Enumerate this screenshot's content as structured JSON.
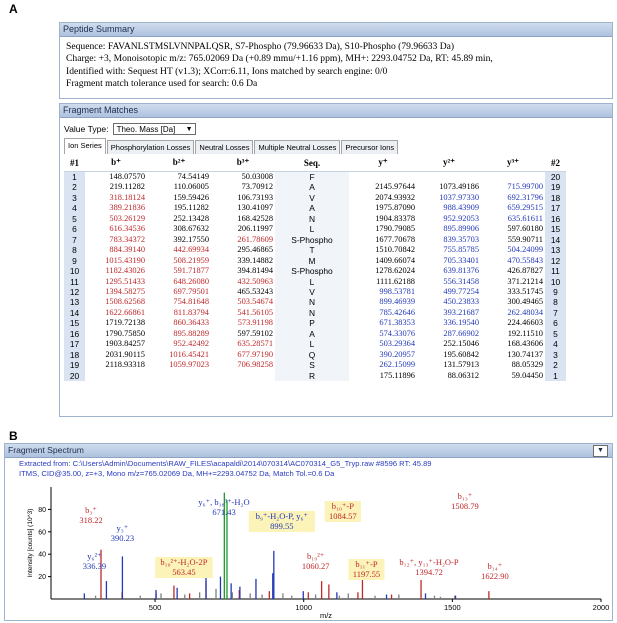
{
  "panel_labels": {
    "a": "A",
    "b": "B"
  },
  "summary": {
    "title": "Peptide Summary",
    "lines": [
      "Sequence: FAVANLSTMSLVNNPALQSR, S7-Phospho (79.96633 Da), S10-Phospho (79.96633 Da)",
      "Charge: +3,   Monoisotopic m/z: 765.02069 Da (+0.89 mmu/+1.16 ppm),     MH+: 2293.04752 Da,    RT: 45.89 min,",
      "Identified with: Sequest HT (v1.3); XCorr:6.11, Ions matched by search engine: 0/0",
      "Fragment match tolerance used for search: 0.6 Da"
    ]
  },
  "fragment_matches": {
    "title": "Fragment Matches",
    "value_type_label": "Value Type:",
    "value_type_selected": "Theo. Mass [Da]",
    "tabs": [
      "Ion Series",
      "Phosphorylation Losses",
      "Neutral Losses",
      "Multiple Neutral Losses",
      "Precursor Ions"
    ],
    "headers": {
      "idx1": "#1",
      "b1": "b⁺",
      "b2": "b²⁺",
      "b3": "b³⁺",
      "seq": "Seq.",
      "y1": "y⁺",
      "y2": "y²⁺",
      "y3": "y³⁺",
      "idx2": "#2"
    },
    "colors": {
      "matched_b": "#c0282a",
      "matched_y": "#2238b8",
      "plain": "#000000"
    },
    "rows": [
      {
        "n1": "1",
        "b1": "148.07570",
        "b2": "74.54149",
        "b3": "50.03008",
        "seq": "F",
        "y1": "",
        "y2": "",
        "y3": "",
        "n2": "20",
        "bc": [
          0,
          0,
          0
        ],
        "yc": [
          0,
          0,
          0
        ]
      },
      {
        "n1": "2",
        "b1": "219.11282",
        "b2": "110.06005",
        "b3": "73.70912",
        "seq": "A",
        "y1": "2145.97644",
        "y2": "1073.49186",
        "y3": "715.99700",
        "n2": "19",
        "bc": [
          0,
          0,
          0
        ],
        "yc": [
          0,
          0,
          1
        ]
      },
      {
        "n1": "3",
        "b1": "318.18124",
        "b2": "159.59426",
        "b3": "106.73193",
        "seq": "V",
        "y1": "2074.93932",
        "y2": "1037.97330",
        "y3": "692.31796",
        "n2": "18",
        "bc": [
          1,
          0,
          0
        ],
        "yc": [
          0,
          1,
          1
        ]
      },
      {
        "n1": "4",
        "b1": "389.21836",
        "b2": "195.11282",
        "b3": "130.41097",
        "seq": "A",
        "y1": "1975.87090",
        "y2": "988.43909",
        "y3": "659.29515",
        "n2": "17",
        "bc": [
          1,
          0,
          0
        ],
        "yc": [
          0,
          1,
          1
        ]
      },
      {
        "n1": "5",
        "b1": "503.26129",
        "b2": "252.13428",
        "b3": "168.42528",
        "seq": "N",
        "y1": "1904.83378",
        "y2": "952.92053",
        "y3": "635.61611",
        "n2": "16",
        "bc": [
          1,
          0,
          0
        ],
        "yc": [
          0,
          1,
          1
        ]
      },
      {
        "n1": "6",
        "b1": "616.34536",
        "b2": "308.67632",
        "b3": "206.11997",
        "seq": "L",
        "y1": "1790.79085",
        "y2": "895.89906",
        "y3": "597.60180",
        "n2": "15",
        "bc": [
          1,
          0,
          0
        ],
        "yc": [
          0,
          1,
          0
        ]
      },
      {
        "n1": "7",
        "b1": "783.34372",
        "b2": "392.17550",
        "b3": "261.78609",
        "seq": "S-Phospho",
        "y1": "1677.70678",
        "y2": "839.35703",
        "y3": "559.90711",
        "n2": "14",
        "bc": [
          1,
          0,
          1
        ],
        "yc": [
          0,
          1,
          0
        ]
      },
      {
        "n1": "8",
        "b1": "884.39140",
        "b2": "442.69934",
        "b3": "295.46865",
        "seq": "T",
        "y1": "1510.70842",
        "y2": "755.85785",
        "y3": "504.24099",
        "n2": "13",
        "bc": [
          1,
          1,
          0
        ],
        "yc": [
          0,
          1,
          1
        ]
      },
      {
        "n1": "9",
        "b1": "1015.43190",
        "b2": "508.21959",
        "b3": "339.14882",
        "seq": "M",
        "y1": "1409.66074",
        "y2": "705.33401",
        "y3": "470.55843",
        "n2": "12",
        "bc": [
          1,
          1,
          0
        ],
        "yc": [
          0,
          1,
          1
        ]
      },
      {
        "n1": "10",
        "b1": "1182.43026",
        "b2": "591.71877",
        "b3": "394.81494",
        "seq": "S-Phospho",
        "y1": "1278.62024",
        "y2": "639.81376",
        "y3": "426.87827",
        "n2": "11",
        "bc": [
          1,
          1,
          0
        ],
        "yc": [
          0,
          1,
          0
        ]
      },
      {
        "n1": "11",
        "b1": "1295.51433",
        "b2": "648.26080",
        "b3": "432.50963",
        "seq": "L",
        "y1": "1111.62188",
        "y2": "556.31458",
        "y3": "371.21214",
        "n2": "10",
        "bc": [
          1,
          1,
          1
        ],
        "yc": [
          0,
          1,
          0
        ]
      },
      {
        "n1": "12",
        "b1": "1394.58275",
        "b2": "697.79501",
        "b3": "465.53243",
        "seq": "V",
        "y1": "998.53781",
        "y2": "499.77254",
        "y3": "333.51745",
        "n2": "9",
        "bc": [
          1,
          1,
          0
        ],
        "yc": [
          1,
          1,
          0
        ]
      },
      {
        "n1": "13",
        "b1": "1508.62568",
        "b2": "754.81648",
        "b3": "503.54674",
        "seq": "N",
        "y1": "899.46939",
        "y2": "450.23833",
        "y3": "300.49465",
        "n2": "8",
        "bc": [
          1,
          1,
          1
        ],
        "yc": [
          1,
          1,
          0
        ]
      },
      {
        "n1": "14",
        "b1": "1622.66861",
        "b2": "811.83794",
        "b3": "541.56105",
        "seq": "N",
        "y1": "785.42646",
        "y2": "393.21687",
        "y3": "262.48034",
        "n2": "7",
        "bc": [
          1,
          1,
          1
        ],
        "yc": [
          1,
          1,
          1
        ]
      },
      {
        "n1": "15",
        "b1": "1719.72138",
        "b2": "860.36433",
        "b3": "573.91198",
        "seq": "P",
        "y1": "671.38353",
        "y2": "336.19540",
        "y3": "224.46603",
        "n2": "6",
        "bc": [
          0,
          1,
          1
        ],
        "yc": [
          1,
          1,
          0
        ]
      },
      {
        "n1": "16",
        "b1": "1790.75850",
        "b2": "895.88289",
        "b3": "597.59102",
        "seq": "A",
        "y1": "574.33076",
        "y2": "287.66902",
        "y3": "192.11510",
        "n2": "5",
        "bc": [
          0,
          1,
          0
        ],
        "yc": [
          1,
          1,
          0
        ]
      },
      {
        "n1": "17",
        "b1": "1903.84257",
        "b2": "952.42492",
        "b3": "635.28571",
        "seq": "L",
        "y1": "503.29364",
        "y2": "252.15046",
        "y3": "168.43606",
        "n2": "4",
        "bc": [
          0,
          1,
          1
        ],
        "yc": [
          1,
          0,
          0
        ]
      },
      {
        "n1": "18",
        "b1": "2031.90115",
        "b2": "1016.45421",
        "b3": "677.97190",
        "seq": "Q",
        "y1": "390.20957",
        "y2": "195.60842",
        "y3": "130.74137",
        "n2": "3",
        "bc": [
          0,
          1,
          1
        ],
        "yc": [
          1,
          0,
          0
        ]
      },
      {
        "n1": "19",
        "b1": "2118.93318",
        "b2": "1059.97023",
        "b3": "706.98258",
        "seq": "S",
        "y1": "262.15099",
        "y2": "131.57913",
        "y3": "88.05329",
        "n2": "2",
        "bc": [
          0,
          1,
          1
        ],
        "yc": [
          1,
          0,
          0
        ]
      },
      {
        "n1": "20",
        "b1": "",
        "b2": "",
        "b3": "",
        "seq": "R",
        "y1": "175.11896",
        "y2": "88.06312",
        "y3": "59.04450",
        "n2": "1",
        "bc": [
          0,
          0,
          0
        ],
        "yc": [
          0,
          0,
          0
        ]
      }
    ]
  },
  "spectrum": {
    "title": "Fragment Spectrum",
    "dropdown_icon": "triangle-down",
    "info_lines": [
      "Extracted from: C:\\Users\\Admin\\Documents\\RAW_FILES\\acapaldi\\2014\\070314\\AC070314_G5_Tryp.raw   #8596   RT: 45.89",
      "ITMS, CID@35.00, z=+3, Mono m/z=765.02069 Da, MH+=2293.04752 Da, Match Tol.=0.6 Da"
    ],
    "highlight_color": "#fbf3b8"
  },
  "chart_data": {
    "type": "bar",
    "xlabel": "m/z",
    "ylabel": "Intensity [counts] (10^3)",
    "xlim": [
      150,
      2000
    ],
    "ylim": [
      0,
      100
    ],
    "x_ticks": [
      "500",
      "1000",
      "1500",
      "2000"
    ],
    "x_tick_values": [
      500,
      1000,
      1500,
      2000
    ],
    "y_ticks": [
      "20",
      "40",
      "60",
      "80"
    ],
    "y_tick_values": [
      20,
      40,
      60,
      80
    ],
    "series": [
      {
        "name": "b ions",
        "color": "#c0282a",
        "peaks": [
          [
            318.2,
            44
          ],
          [
            389.2,
            6
          ],
          [
            503.3,
            5
          ],
          [
            563.5,
            12
          ],
          [
            616.3,
            5
          ],
          [
            671.4,
            16
          ],
          [
            783.3,
            8
          ],
          [
            884.4,
            7
          ],
          [
            1015.4,
            6
          ],
          [
            1060.3,
            16
          ],
          [
            1084.6,
            13
          ],
          [
            1182.4,
            6
          ],
          [
            1197.6,
            17
          ],
          [
            1295.5,
            4
          ],
          [
            1394.7,
            17
          ],
          [
            1508.8,
            3
          ],
          [
            1622.9,
            7
          ]
        ]
      },
      {
        "name": "y ions",
        "color": "#2238b8",
        "peaks": [
          [
            262.2,
            5
          ],
          [
            336.4,
            16
          ],
          [
            390.2,
            38
          ],
          [
            503.3,
            8
          ],
          [
            574.3,
            10
          ],
          [
            671.4,
            32
          ],
          [
            720.0,
            20
          ],
          [
            755.9,
            14
          ],
          [
            785.4,
            11
          ],
          [
            839.4,
            18
          ],
          [
            895.9,
            23
          ],
          [
            899.5,
            43
          ],
          [
            998.5,
            7
          ],
          [
            1111.6,
            6
          ],
          [
            1278.6,
            4
          ],
          [
            1409.7,
            5
          ],
          [
            1510.7,
            3
          ]
        ]
      },
      {
        "name": "precursor",
        "color": "#1c9a2a",
        "peaks": [
          [
            733.0,
            95
          ],
          [
            742.0,
            88
          ]
        ]
      },
      {
        "name": "unassigned",
        "color": "#808080",
        "peaks": [
          [
            300,
            3
          ],
          [
            450,
            3
          ],
          [
            520,
            5
          ],
          [
            600,
            4
          ],
          [
            650,
            6
          ],
          [
            705,
            9
          ],
          [
            760,
            6
          ],
          [
            820,
            5
          ],
          [
            860,
            4
          ],
          [
            930,
            5
          ],
          [
            960,
            3
          ],
          [
            1040,
            4
          ],
          [
            1120,
            3
          ],
          [
            1150,
            5
          ],
          [
            1240,
            3
          ],
          [
            1320,
            4
          ],
          [
            1440,
            3
          ],
          [
            1460,
            2
          ]
        ]
      }
    ],
    "annotations": [
      {
        "lines": [
          "b₃⁺",
          "318.22"
        ],
        "color": "#c0282a",
        "x": 318.2,
        "hl": false
      },
      {
        "lines": [
          "y₃⁺",
          "390.23"
        ],
        "color": "#2238b8",
        "x": 390.2,
        "hl": false
      },
      {
        "lines": [
          "y₆²⁺",
          "336.39"
        ],
        "color": "#2238b8",
        "x": 336.4,
        "hl": false
      },
      {
        "lines": [
          "b₁₀²⁺-H₂O-2P",
          "563.45"
        ],
        "color": "#c0282a",
        "x": 563.5,
        "hl": true
      },
      {
        "lines": [
          "y₆⁺, b₁₈³⁺-H₂O",
          "671.43"
        ],
        "color": "#2238b8",
        "x": 671.4,
        "hl": false
      },
      {
        "lines": [
          "b₉⁺-H₂O-P, y₆⁺",
          "899.55"
        ],
        "color": "#2238b8",
        "x": 899.5,
        "hl": true
      },
      {
        "lines": [
          "b₁₀⁺-P",
          "1084.57"
        ],
        "color": "#c0282a",
        "x": 1084.6,
        "hl": true
      },
      {
        "lines": [
          "b₁₉²⁺",
          "1060.27"
        ],
        "color": "#c0282a",
        "x": 1060.3,
        "hl": false
      },
      {
        "lines": [
          "b₁₁⁺-P",
          "1197.55"
        ],
        "color": "#c0282a",
        "x": 1197.6,
        "hl": true
      },
      {
        "lines": [
          "b₁₂⁺, y₁₃⁺-H₂O-P",
          "1394.72"
        ],
        "color": "#c0282a",
        "x": 1394.7,
        "hl": false
      },
      {
        "lines": [
          "b₁₃⁺",
          "1508.79"
        ],
        "color": "#c0282a",
        "x": 1508.8,
        "hl": false
      },
      {
        "lines": [
          "b₁₄⁺",
          "1622.90"
        ],
        "color": "#c0282a",
        "x": 1622.9,
        "hl": false
      }
    ]
  }
}
